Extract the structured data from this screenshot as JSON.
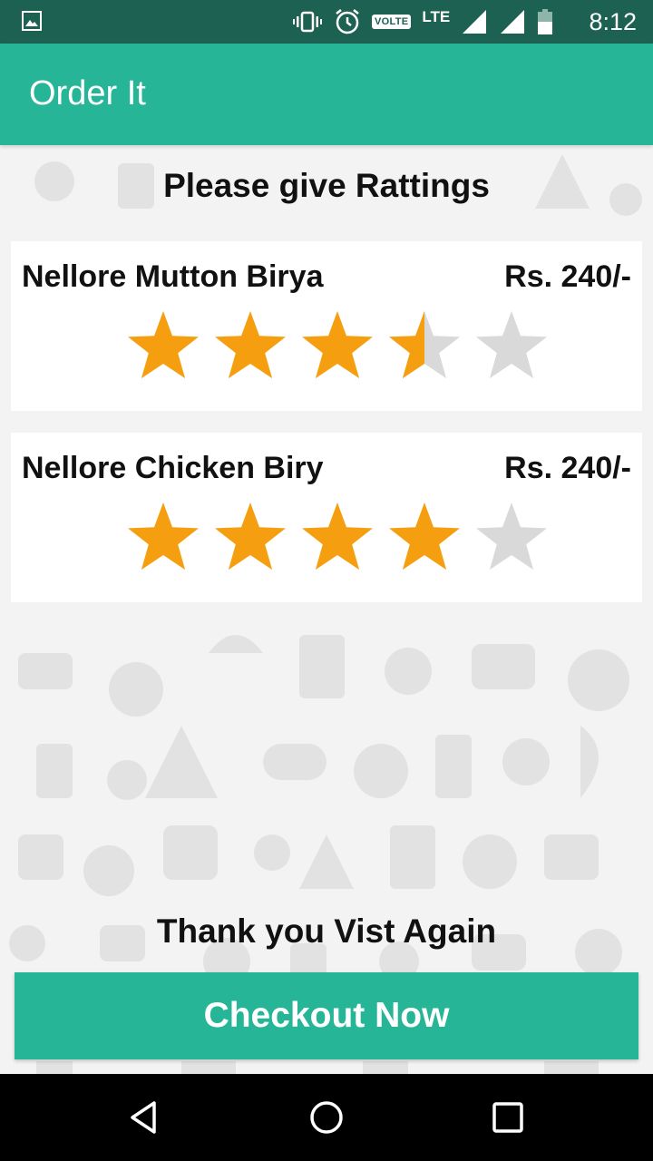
{
  "status_bar": {
    "time": "8:12",
    "volte": "VOLTE",
    "network": "LTE"
  },
  "app_bar": {
    "title": "Order It"
  },
  "heading": "Please give Rattings",
  "items": [
    {
      "name": "Nellore Mutton Birya",
      "price": "Rs. 240/-",
      "rating": 3.5,
      "max_rating": 5
    },
    {
      "name": "Nellore Chicken Biry",
      "price": "Rs. 240/-",
      "rating": 4,
      "max_rating": 5
    }
  ],
  "footer": {
    "thanks": "Thank you Vist Again",
    "checkout_label": "Checkout Now"
  },
  "colors": {
    "accent": "#26b597",
    "status_bar": "#1d6152",
    "star_filled": "#f59f10",
    "star_empty": "#d9d9d9"
  },
  "nav_bar": {
    "icons": [
      "back-icon",
      "home-icon",
      "recents-icon"
    ]
  }
}
